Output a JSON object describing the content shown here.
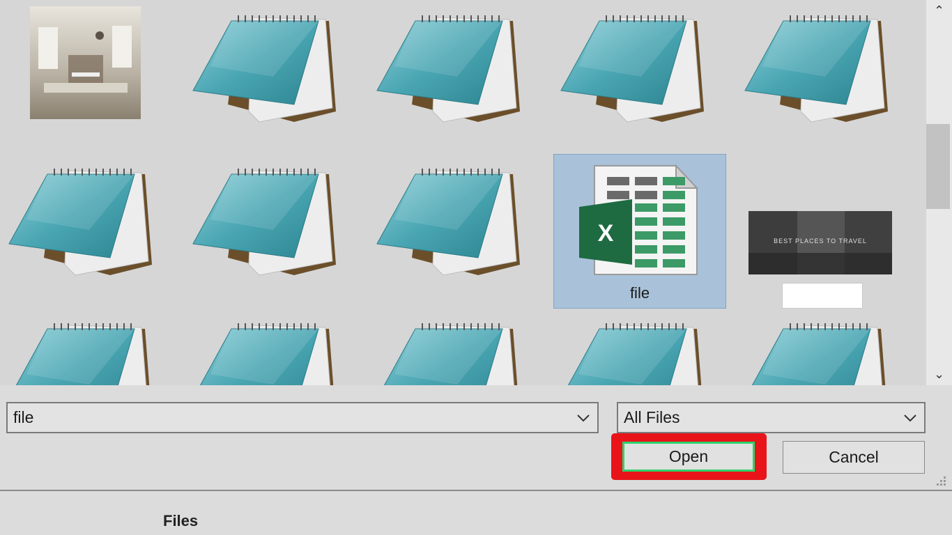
{
  "file_grid": {
    "items": [
      {
        "type": "image",
        "icon": "room-photo-thumbnail"
      },
      {
        "type": "notepad",
        "icon": "notepad-icon"
      },
      {
        "type": "notepad",
        "icon": "notepad-icon"
      },
      {
        "type": "notepad",
        "icon": "notepad-icon"
      },
      {
        "type": "notepad",
        "icon": "notepad-icon"
      },
      {
        "type": "notepad",
        "icon": "notepad-icon"
      },
      {
        "type": "notepad",
        "icon": "notepad-icon"
      },
      {
        "type": "notepad",
        "icon": "notepad-icon"
      },
      {
        "type": "excel",
        "icon": "excel-icon",
        "label": "file",
        "selected": true
      },
      {
        "type": "image",
        "icon": "travel-image-thumbnail",
        "thumb_text": "BEST PLACES TO TRAVEL",
        "label": ""
      },
      {
        "type": "notepad",
        "icon": "notepad-icon"
      },
      {
        "type": "notepad",
        "icon": "notepad-icon"
      },
      {
        "type": "notepad",
        "icon": "notepad-icon"
      },
      {
        "type": "notepad",
        "icon": "notepad-icon"
      },
      {
        "type": "notepad",
        "icon": "notepad-icon"
      }
    ]
  },
  "scrollbar": {
    "up_icon": "chevron-up-icon",
    "down_icon": "chevron-down-icon"
  },
  "filename_field": {
    "value": "file"
  },
  "filetype_select": {
    "value": "All Files"
  },
  "buttons": {
    "open": "Open",
    "cancel": "Cancel"
  },
  "footer": {
    "text": "Files"
  },
  "colors": {
    "selection": "#a9c2da",
    "highlight": "#e8141a",
    "excel_green": "#1e6b41"
  }
}
